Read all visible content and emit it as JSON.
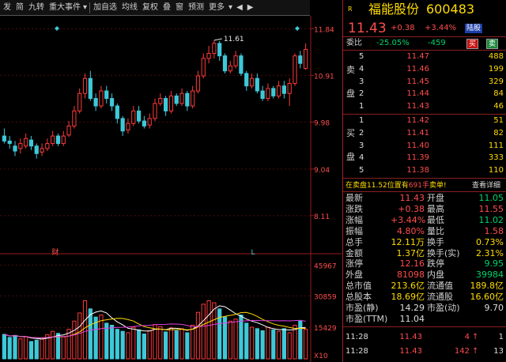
{
  "toolbar": {
    "items": [
      "发",
      "简",
      "九转",
      "重大事件",
      "加自选",
      "均线",
      "复权",
      "叠",
      "窗",
      "预测",
      "更多"
    ],
    "dropdown": "▾",
    "pin": "◆"
  },
  "stock": {
    "name": "福能股份",
    "code": "600483",
    "price": "11.43",
    "change": "+0.38",
    "change_pct": "+3.44%",
    "tag": "陆股",
    "logo": "R"
  },
  "order_ratio": {
    "label": "委比",
    "ratio": "-25.05%",
    "diff": "-459",
    "buy_btn": "买",
    "sell_btn": "卖"
  },
  "sell_label": "卖盘",
  "buy_label": "买盘",
  "asks": [
    {
      "level": "5",
      "price": "11.47",
      "vol": "488"
    },
    {
      "level": "4",
      "price": "11.46",
      "vol": "199"
    },
    {
      "level": "3",
      "price": "11.45",
      "vol": "329"
    },
    {
      "level": "2",
      "price": "11.44",
      "vol": "84"
    },
    {
      "level": "1",
      "price": "11.43",
      "vol": "46"
    }
  ],
  "bids": [
    {
      "level": "1",
      "price": "11.42",
      "vol": "51"
    },
    {
      "level": "2",
      "price": "11.41",
      "vol": "82"
    },
    {
      "level": "3",
      "price": "11.40",
      "vol": "111"
    },
    {
      "level": "4",
      "price": "11.39",
      "vol": "333"
    },
    {
      "level": "5",
      "price": "11.38",
      "vol": "110"
    }
  ],
  "notice": {
    "text_prefix": "在卖盘11.52位置有",
    "text_qty": "691手",
    "text_suffix": "卖单!",
    "link": "查看详细"
  },
  "quote": [
    {
      "l": "最新",
      "lv": "11.43",
      "r": "开盘",
      "rv": "11.05",
      "lc": "red",
      "rc": "green"
    },
    {
      "l": "涨跌",
      "lv": "+0.38",
      "r": "最高",
      "rv": "11.55",
      "lc": "red",
      "rc": "red"
    },
    {
      "l": "涨幅",
      "lv": "+3.44%",
      "r": "最低",
      "rv": "11.02",
      "lc": "red",
      "rc": "green"
    },
    {
      "l": "振幅",
      "lv": "4.80%",
      "r": "量比",
      "rv": "1.58",
      "lc": "red",
      "rc": "red"
    },
    {
      "l": "总手",
      "lv": "12.11万",
      "r": "换手",
      "rv": "0.73%",
      "lc": "yellow",
      "rc": "yellow"
    },
    {
      "l": "金额",
      "lv": "1.37亿",
      "r": "换手(实)",
      "rv": "2.31%",
      "lc": "yellow",
      "rc": "yellow"
    },
    {
      "l": "涨停",
      "lv": "12.16",
      "r": "跌停",
      "rv": "9.95",
      "lc": "red",
      "rc": "green"
    },
    {
      "l": "外盘",
      "lv": "81098",
      "r": "内盘",
      "rv": "39984",
      "lc": "red",
      "rc": "green"
    },
    {
      "l": "总市值",
      "lv": "213.6亿",
      "r": "流通值",
      "rv": "189.8亿",
      "lc": "yellow",
      "rc": "yellow"
    },
    {
      "l": "总股本",
      "lv": "18.69亿",
      "r": "流通股",
      "rv": "16.60亿",
      "lc": "yellow",
      "rc": "yellow"
    },
    {
      "l": "市盈(静)",
      "lv": "14.29",
      "r": "市盈(动)",
      "rv": "9.70",
      "lc": "white",
      "rc": "white"
    },
    {
      "l": "市盈(TTM)",
      "lv": "11.04",
      "r": "",
      "rv": "",
      "lc": "white",
      "rc": "white"
    }
  ],
  "ticks": [
    {
      "time": "11:28",
      "price": "11.43",
      "vol": "4",
      "count": "1"
    },
    {
      "time": "11:28",
      "price": "11.43",
      "vol": "142",
      "count": "13"
    }
  ],
  "chart_data": [
    {
      "type": "candlestick",
      "price_axis_labels": [
        "11.84",
        "10.91",
        "9.98",
        "9.04",
        "8.11"
      ],
      "yrange": [
        7.35,
        12.1
      ],
      "annotation_high": "11.61",
      "markers": {
        "cai": "财",
        "l": "L"
      },
      "candles": [
        [
          9.7,
          9.6,
          9.85,
          9.55
        ],
        [
          9.6,
          9.55,
          9.7,
          9.45
        ],
        [
          9.5,
          9.4,
          9.6,
          9.3
        ],
        [
          9.45,
          9.55,
          9.65,
          9.35
        ],
        [
          9.5,
          9.65,
          9.75,
          9.45
        ],
        [
          9.62,
          9.5,
          9.7,
          9.42
        ],
        [
          9.5,
          9.35,
          9.55,
          9.25
        ],
        [
          9.38,
          9.45,
          9.55,
          9.3
        ],
        [
          9.45,
          9.55,
          9.65,
          9.4
        ],
        [
          9.55,
          9.7,
          9.8,
          9.5
        ],
        [
          9.7,
          9.55,
          9.75,
          9.5
        ],
        [
          9.55,
          9.7,
          9.8,
          9.5
        ],
        [
          9.72,
          9.9,
          10.0,
          9.68
        ],
        [
          9.9,
          10.2,
          10.3,
          9.85
        ],
        [
          10.2,
          10.55,
          10.65,
          10.15
        ],
        [
          10.55,
          10.85,
          10.95,
          10.45
        ],
        [
          10.85,
          10.45,
          11.0,
          10.4
        ],
        [
          10.45,
          10.3,
          10.55,
          10.2
        ],
        [
          10.3,
          10.6,
          10.7,
          10.25
        ],
        [
          10.6,
          10.45,
          10.7,
          10.35
        ],
        [
          10.45,
          10.3,
          10.55,
          10.2
        ],
        [
          10.3,
          10.05,
          10.35,
          9.95
        ],
        [
          10.05,
          9.8,
          10.1,
          9.7
        ],
        [
          9.82,
          9.95,
          10.05,
          9.75
        ],
        [
          9.95,
          10.2,
          10.3,
          9.9
        ],
        [
          10.2,
          10.0,
          10.3,
          9.95
        ],
        [
          10.0,
          9.9,
          10.1,
          9.85
        ],
        [
          9.92,
          10.05,
          10.15,
          9.85
        ],
        [
          10.05,
          10.35,
          10.45,
          10.0
        ],
        [
          10.35,
          10.45,
          10.55,
          10.3
        ],
        [
          10.45,
          10.2,
          10.5,
          10.1
        ],
        [
          10.2,
          10.5,
          10.6,
          10.15
        ],
        [
          10.5,
          10.35,
          10.55,
          10.3
        ],
        [
          10.35,
          10.55,
          10.65,
          10.3
        ],
        [
          10.55,
          10.3,
          10.6,
          10.2
        ],
        [
          10.3,
          10.6,
          10.7,
          10.25
        ],
        [
          10.6,
          10.9,
          11.0,
          10.55
        ],
        [
          10.9,
          11.25,
          11.35,
          10.85
        ],
        [
          11.25,
          11.35,
          11.5,
          11.15
        ],
        [
          11.35,
          11.55,
          11.61,
          11.25
        ],
        [
          11.55,
          11.3,
          11.6,
          11.2
        ],
        [
          11.3,
          11.0,
          11.35,
          10.95
        ],
        [
          11.0,
          11.1,
          11.2,
          10.95
        ],
        [
          11.1,
          11.3,
          11.4,
          11.05
        ],
        [
          11.3,
          10.95,
          11.35,
          10.9
        ],
        [
          10.95,
          10.7,
          11.0,
          10.6
        ],
        [
          10.7,
          10.85,
          10.95,
          10.65
        ],
        [
          10.85,
          10.6,
          10.95,
          10.55
        ],
        [
          10.6,
          10.45,
          10.7,
          10.4
        ],
        [
          10.45,
          10.65,
          10.75,
          10.4
        ],
        [
          10.65,
          10.5,
          10.7,
          10.45
        ],
        [
          10.5,
          10.7,
          10.8,
          10.45
        ],
        [
          10.7,
          10.55,
          10.8,
          10.45
        ],
        [
          10.55,
          10.75,
          10.85,
          10.3
        ],
        [
          10.75,
          11.3,
          11.35,
          10.7
        ],
        [
          11.3,
          11.15,
          11.4,
          11.05
        ],
        [
          11.05,
          11.43,
          11.55,
          11.02
        ]
      ]
    },
    {
      "type": "bar",
      "title": "volume",
      "axis_labels": [
        "45967",
        "30859",
        "15429"
      ],
      "unit_label": "X10",
      "ymax": 50000,
      "values": [
        12000,
        10500,
        11500,
        9800,
        10800,
        8500,
        9200,
        10200,
        11800,
        13500,
        12500,
        10800,
        14500,
        18500,
        22500,
        28500,
        24500,
        20500,
        21500,
        17500,
        16500,
        14500,
        13500,
        12800,
        15500,
        14200,
        12200,
        13800,
        16800,
        15800,
        13200,
        15200,
        13800,
        14800,
        12800,
        16500,
        22800,
        26800,
        28500,
        27500,
        24500,
        20500,
        18500,
        19500,
        21500,
        17500,
        15500,
        14800,
        13800,
        15500,
        14200,
        13500,
        14800,
        12800,
        16500,
        18500,
        14500
      ]
    }
  ]
}
